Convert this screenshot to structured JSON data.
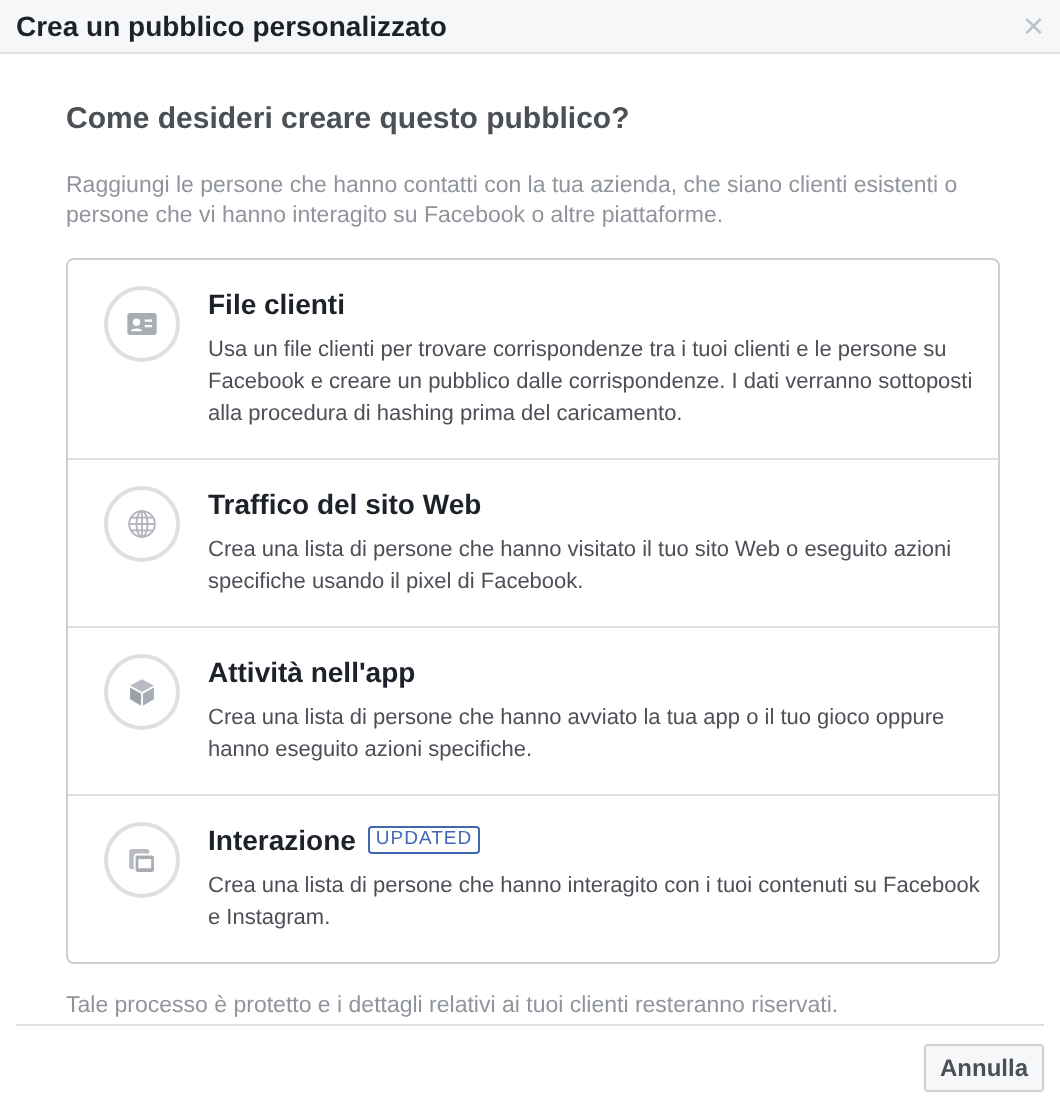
{
  "dialog": {
    "title": "Crea un pubblico personalizzato",
    "close": "×"
  },
  "heading": "Come desideri creare questo pubblico?",
  "intro": "Raggiungi le persone che hanno contatti con la tua azienda, che siano clienti esistenti o persone che vi hanno interagito su Facebook o altre piattaforme.",
  "options": [
    {
      "kind": "contact-card",
      "title": "File clienti",
      "description": "Usa un file clienti per trovare corrispondenze tra i tuoi clienti e le persone su Facebook e creare un pubblico dalle corrispondenze. I dati verranno sottoposti alla procedura di hashing prima del caricamento."
    },
    {
      "kind": "globe",
      "title": "Traffico del sito Web",
      "description": "Crea una lista di persone che hanno visitato il tuo sito Web o eseguito azioni specifiche usando il pixel di Facebook."
    },
    {
      "kind": "cube",
      "title": "Attività nell'app",
      "description": "Crea una lista di persone che hanno avviato la tua app o il tuo gioco oppure hanno eseguito azioni specifiche."
    },
    {
      "kind": "stack",
      "title": "Interazione",
      "badge": "UPDATED",
      "description": "Crea una lista di persone che hanno interagito con i tuoi contenuti su Facebook e Instagram."
    }
  ],
  "note": "Tale processo è protetto e i dettagli relativi ai tuoi clienti resteranno riservati.",
  "buttons": [
    "Annulla"
  ]
}
